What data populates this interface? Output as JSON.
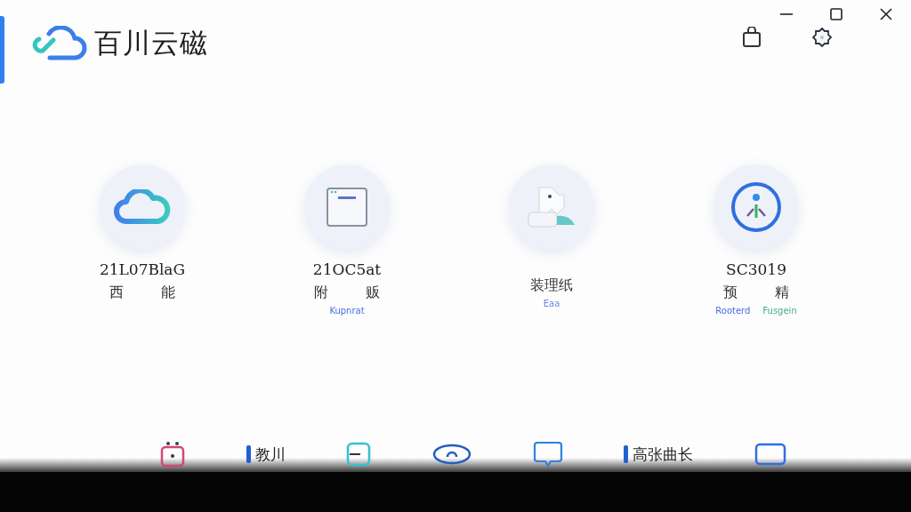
{
  "app": {
    "title": "百川云磁"
  },
  "tiles": [
    {
      "kind": "cloud",
      "title": "21L07BlaG",
      "labels": [
        "西",
        "能"
      ]
    },
    {
      "kind": "window",
      "title": "21OC5at",
      "labels": [
        "附",
        "贩"
      ],
      "captions": [
        {
          "text": "Kupnrat",
          "color": "#4a6ee0"
        }
      ]
    },
    {
      "kind": "cards",
      "labels": [
        "装理纸"
      ],
      "captions": [
        {
          "text": "Eaa",
          "color": "#6f86e0"
        }
      ]
    },
    {
      "kind": "gauge",
      "title": "SC3019",
      "labels": [
        "预",
        "精"
      ],
      "captions": [
        {
          "text": "Rooterd",
          "color": "#4a6ee0"
        },
        {
          "text": "Fusgein",
          "color": "#3fb08a"
        }
      ]
    }
  ],
  "dock": [
    {
      "kind": "tv"
    },
    {
      "kind": "text",
      "text": "教川"
    },
    {
      "kind": "square"
    },
    {
      "kind": "eye"
    },
    {
      "kind": "chat"
    },
    {
      "kind": "text",
      "text": "高张曲长"
    },
    {
      "kind": "rect"
    }
  ]
}
